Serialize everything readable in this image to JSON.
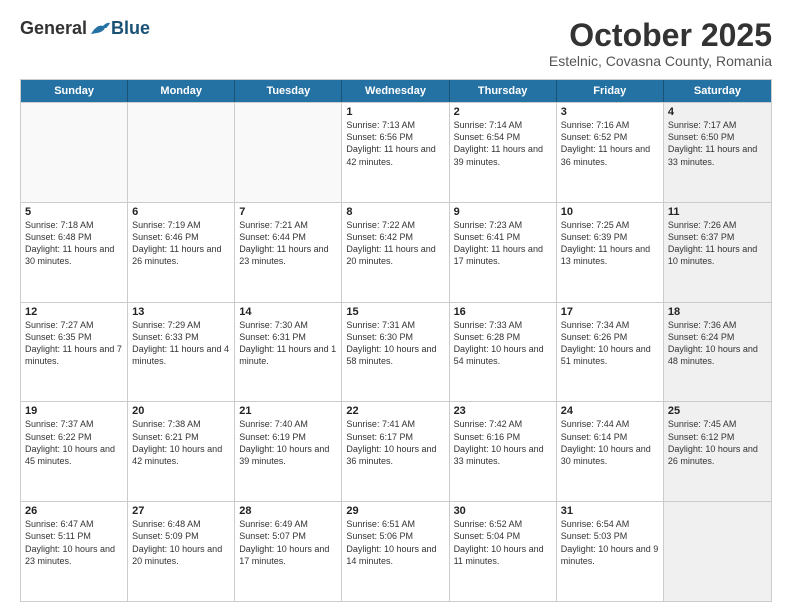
{
  "header": {
    "logo_general": "General",
    "logo_blue": "Blue",
    "month_title": "October 2025",
    "subtitle": "Estelnic, Covasna County, Romania"
  },
  "weekdays": [
    "Sunday",
    "Monday",
    "Tuesday",
    "Wednesday",
    "Thursday",
    "Friday",
    "Saturday"
  ],
  "rows": [
    [
      {
        "day": "",
        "text": "",
        "empty": true
      },
      {
        "day": "",
        "text": "",
        "empty": true
      },
      {
        "day": "",
        "text": "",
        "empty": true
      },
      {
        "day": "1",
        "text": "Sunrise: 7:13 AM\nSunset: 6:56 PM\nDaylight: 11 hours and 42 minutes."
      },
      {
        "day": "2",
        "text": "Sunrise: 7:14 AM\nSunset: 6:54 PM\nDaylight: 11 hours and 39 minutes."
      },
      {
        "day": "3",
        "text": "Sunrise: 7:16 AM\nSunset: 6:52 PM\nDaylight: 11 hours and 36 minutes."
      },
      {
        "day": "4",
        "text": "Sunrise: 7:17 AM\nSunset: 6:50 PM\nDaylight: 11 hours and 33 minutes.",
        "shaded": true
      }
    ],
    [
      {
        "day": "5",
        "text": "Sunrise: 7:18 AM\nSunset: 6:48 PM\nDaylight: 11 hours and 30 minutes."
      },
      {
        "day": "6",
        "text": "Sunrise: 7:19 AM\nSunset: 6:46 PM\nDaylight: 11 hours and 26 minutes."
      },
      {
        "day": "7",
        "text": "Sunrise: 7:21 AM\nSunset: 6:44 PM\nDaylight: 11 hours and 23 minutes."
      },
      {
        "day": "8",
        "text": "Sunrise: 7:22 AM\nSunset: 6:42 PM\nDaylight: 11 hours and 20 minutes."
      },
      {
        "day": "9",
        "text": "Sunrise: 7:23 AM\nSunset: 6:41 PM\nDaylight: 11 hours and 17 minutes."
      },
      {
        "day": "10",
        "text": "Sunrise: 7:25 AM\nSunset: 6:39 PM\nDaylight: 11 hours and 13 minutes."
      },
      {
        "day": "11",
        "text": "Sunrise: 7:26 AM\nSunset: 6:37 PM\nDaylight: 11 hours and 10 minutes.",
        "shaded": true
      }
    ],
    [
      {
        "day": "12",
        "text": "Sunrise: 7:27 AM\nSunset: 6:35 PM\nDaylight: 11 hours and 7 minutes."
      },
      {
        "day": "13",
        "text": "Sunrise: 7:29 AM\nSunset: 6:33 PM\nDaylight: 11 hours and 4 minutes."
      },
      {
        "day": "14",
        "text": "Sunrise: 7:30 AM\nSunset: 6:31 PM\nDaylight: 11 hours and 1 minute."
      },
      {
        "day": "15",
        "text": "Sunrise: 7:31 AM\nSunset: 6:30 PM\nDaylight: 10 hours and 58 minutes."
      },
      {
        "day": "16",
        "text": "Sunrise: 7:33 AM\nSunset: 6:28 PM\nDaylight: 10 hours and 54 minutes."
      },
      {
        "day": "17",
        "text": "Sunrise: 7:34 AM\nSunset: 6:26 PM\nDaylight: 10 hours and 51 minutes."
      },
      {
        "day": "18",
        "text": "Sunrise: 7:36 AM\nSunset: 6:24 PM\nDaylight: 10 hours and 48 minutes.",
        "shaded": true
      }
    ],
    [
      {
        "day": "19",
        "text": "Sunrise: 7:37 AM\nSunset: 6:22 PM\nDaylight: 10 hours and 45 minutes."
      },
      {
        "day": "20",
        "text": "Sunrise: 7:38 AM\nSunset: 6:21 PM\nDaylight: 10 hours and 42 minutes."
      },
      {
        "day": "21",
        "text": "Sunrise: 7:40 AM\nSunset: 6:19 PM\nDaylight: 10 hours and 39 minutes."
      },
      {
        "day": "22",
        "text": "Sunrise: 7:41 AM\nSunset: 6:17 PM\nDaylight: 10 hours and 36 minutes."
      },
      {
        "day": "23",
        "text": "Sunrise: 7:42 AM\nSunset: 6:16 PM\nDaylight: 10 hours and 33 minutes."
      },
      {
        "day": "24",
        "text": "Sunrise: 7:44 AM\nSunset: 6:14 PM\nDaylight: 10 hours and 30 minutes."
      },
      {
        "day": "25",
        "text": "Sunrise: 7:45 AM\nSunset: 6:12 PM\nDaylight: 10 hours and 26 minutes.",
        "shaded": true
      }
    ],
    [
      {
        "day": "26",
        "text": "Sunrise: 6:47 AM\nSunset: 5:11 PM\nDaylight: 10 hours and 23 minutes."
      },
      {
        "day": "27",
        "text": "Sunrise: 6:48 AM\nSunset: 5:09 PM\nDaylight: 10 hours and 20 minutes."
      },
      {
        "day": "28",
        "text": "Sunrise: 6:49 AM\nSunset: 5:07 PM\nDaylight: 10 hours and 17 minutes."
      },
      {
        "day": "29",
        "text": "Sunrise: 6:51 AM\nSunset: 5:06 PM\nDaylight: 10 hours and 14 minutes."
      },
      {
        "day": "30",
        "text": "Sunrise: 6:52 AM\nSunset: 5:04 PM\nDaylight: 10 hours and 11 minutes."
      },
      {
        "day": "31",
        "text": "Sunrise: 6:54 AM\nSunset: 5:03 PM\nDaylight: 10 hours and 9 minutes."
      },
      {
        "day": "",
        "text": "",
        "empty": true,
        "shaded": true
      }
    ]
  ]
}
